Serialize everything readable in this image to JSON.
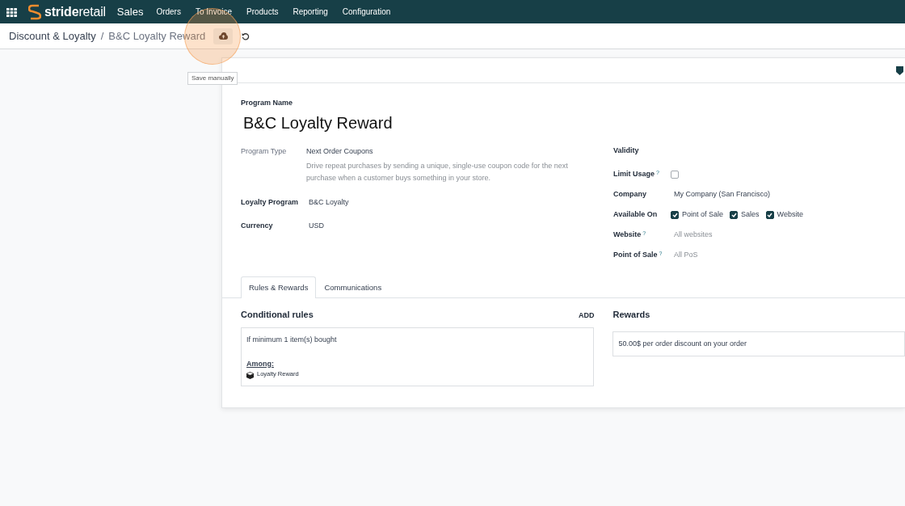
{
  "navbar": {
    "brand": "**stride**retail",
    "app_name": "Sales",
    "menu": [
      "Orders",
      "To Invoice",
      "Products",
      "Reporting",
      "Configuration"
    ]
  },
  "breadcrumb": {
    "parent": "Discount & Loyalty",
    "separator": "/",
    "current": "B&C Loyalty Reward",
    "save_tooltip": "Save manually"
  },
  "form": {
    "name_label": "Program Name",
    "name": "B&C Loyalty Reward",
    "left_fields": [
      {
        "label": "Program Type",
        "label_muted": true,
        "value": "Next Order Coupons",
        "description": "Drive repeat purchases by sending a unique, single-use coupon code for the next purchase when a customer buys something in your store."
      },
      {
        "label": "Loyalty Program",
        "label_muted": false,
        "value": "B&C Loyalty"
      },
      {
        "label": "Currency",
        "label_muted": false,
        "value": "USD"
      }
    ],
    "right_fields": [
      {
        "kind": "heading",
        "label": "Validity"
      },
      {
        "kind": "checkbox",
        "label": "Limit Usage",
        "help": "?",
        "checked": false
      },
      {
        "kind": "text",
        "label": "Company",
        "value": "My Company (San Francisco)"
      },
      {
        "kind": "checkboxes",
        "label": "Available On",
        "options": [
          {
            "label": "Point of Sale",
            "checked": true
          },
          {
            "label": "Sales",
            "checked": true
          },
          {
            "label": "Website",
            "checked": true
          }
        ]
      },
      {
        "kind": "placeholder",
        "label": "Website",
        "help": "?",
        "placeholder": "All websites"
      },
      {
        "kind": "placeholder",
        "label": "Point of Sale",
        "help": "?",
        "placeholder": "All PoS"
      }
    ]
  },
  "tabs": [
    {
      "label": "Rules & Rewards",
      "selected": true
    },
    {
      "label": "Communications",
      "selected": false
    }
  ],
  "rules": {
    "title": "Conditional rules",
    "add": "ADD",
    "items": [
      {
        "text": "If minimum 1 item(s) bought",
        "among_label": "Among:",
        "products": [
          "Loyalty Reward"
        ]
      }
    ]
  },
  "rewards": {
    "title": "Rewards",
    "items": [
      "50.00$ per order discount on your order"
    ]
  }
}
